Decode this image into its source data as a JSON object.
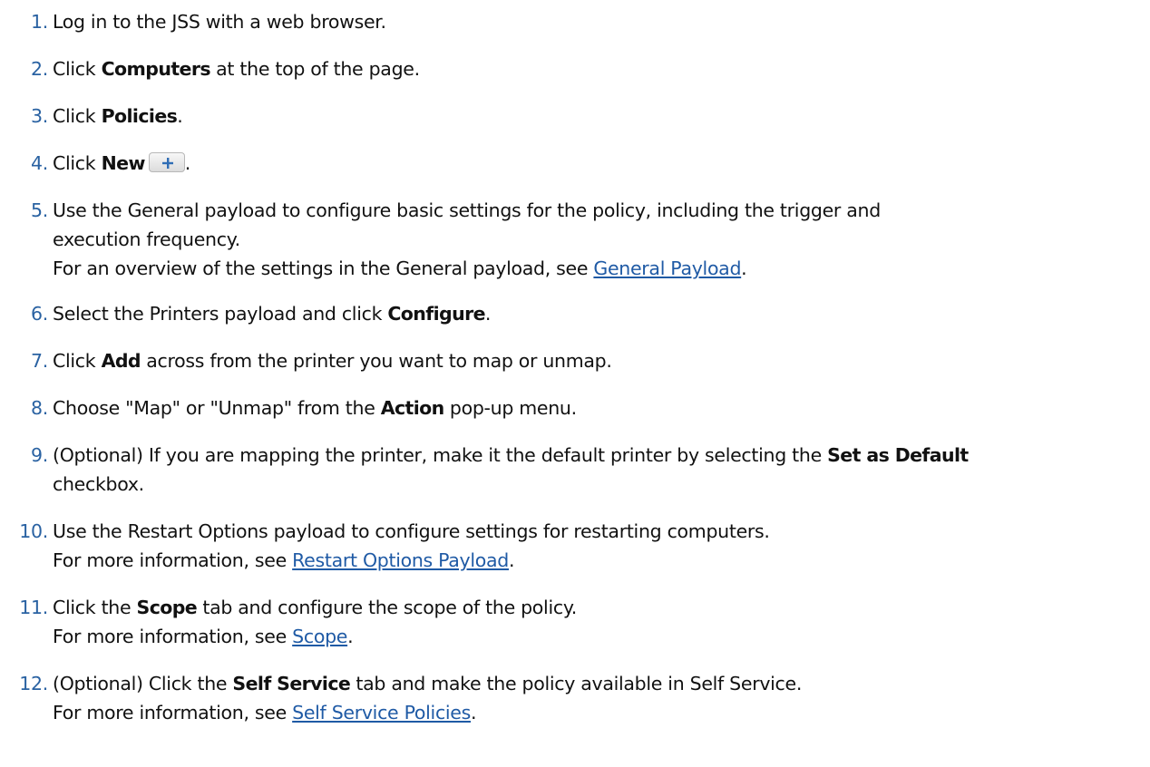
{
  "steps": [
    {
      "num": "1.",
      "lines": [
        {
          "t1": "Log in to the JSS with a web browser."
        }
      ]
    },
    {
      "num": "2.",
      "lines": [
        {
          "t1": "Click ",
          "b1": "Computers",
          "t2": " at the top of the page."
        }
      ]
    },
    {
      "num": "3.",
      "lines": [
        {
          "t1": "Click ",
          "b1": "Policies",
          "t2": "."
        }
      ]
    },
    {
      "num": "4.",
      "lines": [
        {
          "t1": "Click ",
          "b1": "New",
          "t2": "."
        }
      ]
    },
    {
      "num": "5.",
      "lines": [
        {
          "t1": "Use the General payload to configure basic settings for the policy, including the trigger and"
        },
        {
          "t1": "execution frequency."
        },
        {
          "t1": "For an overview of the settings in the General payload, see ",
          "link": "General Payload",
          "t2": "."
        }
      ]
    },
    {
      "num": "6.",
      "lines": [
        {
          "t1": "Select the Printers payload and click ",
          "b1": "Configure",
          "t2": "."
        }
      ]
    },
    {
      "num": "7.",
      "lines": [
        {
          "t1": "Click ",
          "b1": "Add",
          "t2": " across from the printer you want to map or unmap."
        }
      ]
    },
    {
      "num": "8.",
      "lines": [
        {
          "t1": "Choose \"Map\" or \"Unmap\" from the ",
          "b1": "Action",
          "t2": " pop-up menu."
        }
      ]
    },
    {
      "num": "9.",
      "lines": [
        {
          "t1": "(Optional) If you are mapping the printer, make it the default printer by selecting the ",
          "b1": "Set as Default"
        },
        {
          "t1": "checkbox."
        }
      ]
    },
    {
      "num": "10.",
      "lines": [
        {
          "t1": "Use the Restart Options payload to configure settings for restarting computers."
        },
        {
          "t1": "For more information, see ",
          "link": "Restart Options Payload",
          "t2": "."
        }
      ]
    },
    {
      "num": "11.",
      "lines": [
        {
          "t1": "Click the ",
          "b1": "Scope",
          "t2": " tab and configure the scope of the policy."
        },
        {
          "t1": "For more information, see ",
          "link": "Scope",
          "t2": "."
        }
      ]
    },
    {
      "num": "12.",
      "lines": [
        {
          "t1": "(Optional) Click the ",
          "b1": "Self Service",
          "t2": " tab and make the policy available in Self Service."
        },
        {
          "t1": "For more information, see ",
          "link": "Self Service Policies",
          "t2": "."
        }
      ]
    }
  ],
  "icons": {
    "new_button_icon": "plus-icon"
  },
  "colors": {
    "number": "#2a62a2",
    "link": "#1f5aa5",
    "text": "#111111"
  }
}
